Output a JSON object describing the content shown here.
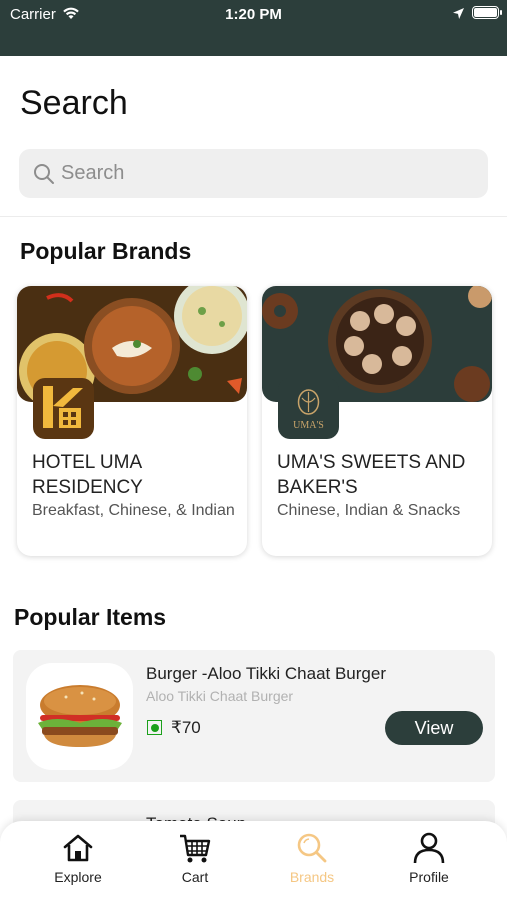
{
  "status_bar": {
    "carrier": "Carrier",
    "time": "1:20 PM"
  },
  "page": {
    "title": "Search"
  },
  "search": {
    "placeholder": "Search",
    "value": ""
  },
  "popular_brands": {
    "title": "Popular Brands",
    "brands": [
      {
        "name": "HOTEL UMA RESIDENCY",
        "cuisine": "Breakfast, Chinese, & Indian"
      },
      {
        "name": "UMA'S SWEETS AND BAKER'S",
        "cuisine": "Chinese, Indian & Snacks",
        "logo_text": "UMA'S"
      }
    ]
  },
  "popular_items": {
    "title": "Popular Items",
    "items": [
      {
        "name": "Burger -Aloo Tikki Chaat Burger",
        "subtitle": "Aloo Tikki Chaat Burger",
        "price": "₹70",
        "type": "veg",
        "button": "View"
      },
      {
        "name": "Tomato Soup"
      }
    ]
  },
  "tab_bar": {
    "tabs": [
      {
        "label": "Explore",
        "icon": "home-icon"
      },
      {
        "label": "Cart",
        "icon": "cart-icon"
      },
      {
        "label": "Brands",
        "icon": "search-icon",
        "active": true
      },
      {
        "label": "Profile",
        "icon": "person-icon"
      }
    ]
  },
  "colors": {
    "header_bg": "#2c3e3b",
    "accent": "#f5c784",
    "veg_green": "#1aa01a",
    "button_bg": "#2c3e3b"
  }
}
